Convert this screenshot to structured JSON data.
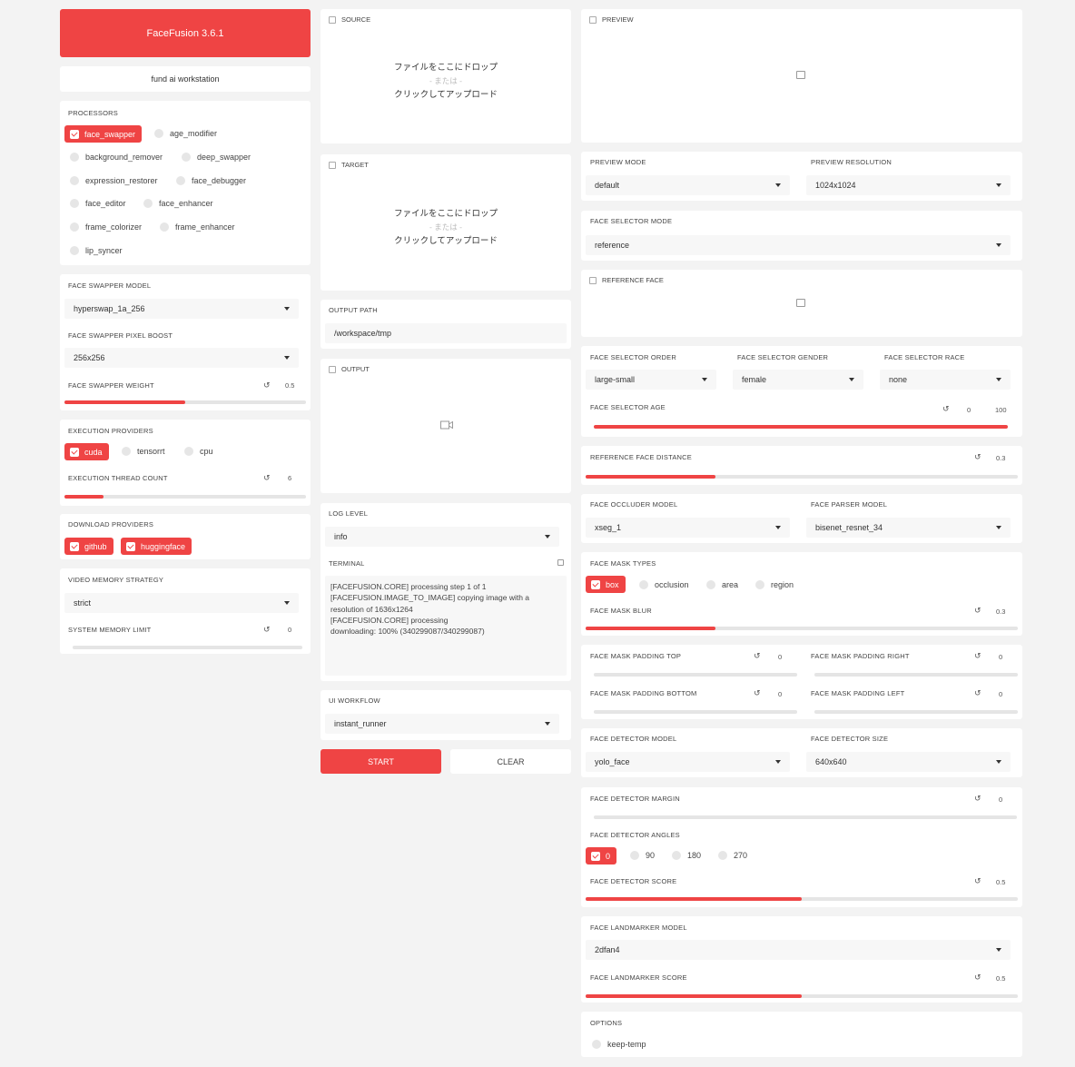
{
  "app": {
    "title": "FaceFusion 3.6.1",
    "subtitle": "fund ai workstation"
  },
  "processors": {
    "label": "PROCESSORS",
    "items": [
      {
        "label": "face_swapper",
        "checked": true
      },
      {
        "label": "age_modifier",
        "checked": false
      },
      {
        "label": "background_remover",
        "checked": false
      },
      {
        "label": "deep_swapper",
        "checked": false
      },
      {
        "label": "expression_restorer",
        "checked": false
      },
      {
        "label": "face_debugger",
        "checked": false
      },
      {
        "label": "face_editor",
        "checked": false
      },
      {
        "label": "face_enhancer",
        "checked": false
      },
      {
        "label": "frame_colorizer",
        "checked": false
      },
      {
        "label": "frame_enhancer",
        "checked": false
      },
      {
        "label": "lip_syncer",
        "checked": false
      }
    ]
  },
  "face_swapper": {
    "model_label": "FACE SWAPPER MODEL",
    "model_value": "hyperswap_1a_256",
    "boost_label": "FACE SWAPPER PIXEL BOOST",
    "boost_value": "256x256",
    "weight_label": "FACE SWAPPER WEIGHT",
    "weight_value": "0.5",
    "weight_fraction": 0.5
  },
  "execution": {
    "providers_label": "EXECUTION PROVIDERS",
    "providers": [
      {
        "label": "cuda",
        "checked": true
      },
      {
        "label": "tensorrt",
        "checked": false
      },
      {
        "label": "cpu",
        "checked": false
      }
    ],
    "thread_label": "EXECUTION THREAD COUNT",
    "thread_value": "6",
    "thread_fraction": 0.16
  },
  "download": {
    "label": "DOWNLOAD PROVIDERS",
    "providers": [
      {
        "label": "github",
        "checked": true
      },
      {
        "label": "huggingface",
        "checked": true
      }
    ]
  },
  "memory": {
    "strategy_label": "VIDEO MEMORY STRATEGY",
    "strategy_value": "strict",
    "limit_label": "SYSTEM MEMORY LIMIT",
    "limit_value": "0",
    "limit_fraction": 0
  },
  "source": {
    "label": "SOURCE",
    "drop_line1": "ファイルをここにドロップ",
    "drop_or": "- または -",
    "drop_line2": "クリックしてアップロード"
  },
  "target": {
    "label": "TARGET",
    "drop_line1": "ファイルをここにドロップ",
    "drop_or": "- または -",
    "drop_line2": "クリックしてアップロード"
  },
  "output_path": {
    "label": "OUTPUT PATH",
    "value": "/workspace/tmp"
  },
  "output": {
    "label": "OUTPUT"
  },
  "log": {
    "label": "LOG LEVEL",
    "value": "info"
  },
  "terminal": {
    "label": "TERMINAL",
    "lines": [
      "[FACEFUSION.CORE] processing step 1 of 1",
      "[FACEFUSION.IMAGE_TO_IMAGE] copying image with a resolution of 1636x1264",
      "[FACEFUSION.CORE] processing",
      "downloading: 100% (340299087/340299087)"
    ]
  },
  "workflow": {
    "label": "UI WORKFLOW",
    "value": "instant_runner"
  },
  "actions": {
    "start": "START",
    "clear": "CLEAR"
  },
  "preview": {
    "label": "PREVIEW",
    "mode_label": "PREVIEW MODE",
    "mode_value": "default",
    "resolution_label": "PREVIEW RESOLUTION",
    "resolution_value": "1024x1024"
  },
  "face_selector": {
    "mode_label": "FACE SELECTOR MODE",
    "mode_value": "reference",
    "reference_label": "REFERENCE FACE",
    "order_label": "FACE SELECTOR ORDER",
    "order_value": "large-small",
    "gender_label": "FACE SELECTOR GENDER",
    "gender_value": "female",
    "race_label": "FACE SELECTOR RACE",
    "race_value": "none",
    "age_label": "FACE SELECTOR AGE",
    "age_min": "0",
    "age_max": "100",
    "distance_label": "REFERENCE FACE DISTANCE",
    "distance_value": "0.3",
    "distance_fraction": 0.3
  },
  "face_masker": {
    "occluder_label": "FACE OCCLUDER MODEL",
    "occluder_value": "xseg_1",
    "parser_label": "FACE PARSER MODEL",
    "parser_value": "bisenet_resnet_34",
    "types_label": "FACE MASK TYPES",
    "types": [
      {
        "label": "box",
        "checked": true
      },
      {
        "label": "occlusion",
        "checked": false
      },
      {
        "label": "area",
        "checked": false
      },
      {
        "label": "region",
        "checked": false
      }
    ],
    "blur_label": "FACE MASK BLUR",
    "blur_value": "0.3",
    "blur_fraction": 0.3,
    "pad_top_label": "FACE MASK PADDING TOP",
    "pad_top_value": "0",
    "pad_right_label": "FACE MASK PADDING RIGHT",
    "pad_right_value": "0",
    "pad_bottom_label": "FACE MASK PADDING BOTTOM",
    "pad_bottom_value": "0",
    "pad_left_label": "FACE MASK PADDING LEFT",
    "pad_left_value": "0"
  },
  "face_detector": {
    "model_label": "FACE DETECTOR MODEL",
    "model_value": "yolo_face",
    "size_label": "FACE DETECTOR SIZE",
    "size_value": "640x640",
    "margin_label": "FACE DETECTOR MARGIN",
    "margin_value": "0",
    "angles_label": "FACE DETECTOR ANGLES",
    "angles": [
      {
        "label": "0",
        "checked": true
      },
      {
        "label": "90",
        "checked": false
      },
      {
        "label": "180",
        "checked": false
      },
      {
        "label": "270",
        "checked": false
      }
    ],
    "score_label": "FACE DETECTOR SCORE",
    "score_value": "0.5",
    "score_fraction": 0.5
  },
  "face_landmarker": {
    "model_label": "FACE LANDMARKER MODEL",
    "model_value": "2dfan4",
    "score_label": "FACE LANDMARKER SCORE",
    "score_value": "0.5",
    "score_fraction": 0.5
  },
  "options": {
    "label": "OPTIONS",
    "keep_temp": "keep-temp"
  },
  "colors": {
    "accent": "#ef4444",
    "background": "#f3f3f3",
    "panel": "#ffffff"
  }
}
